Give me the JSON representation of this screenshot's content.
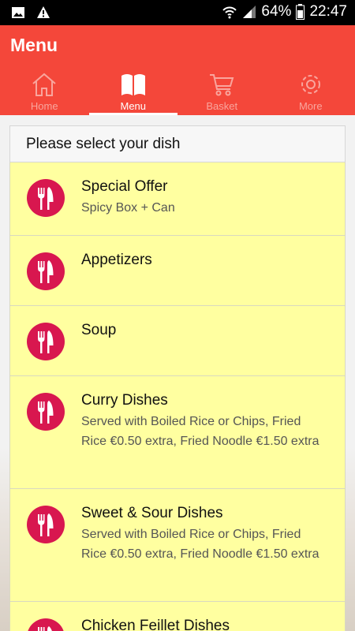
{
  "status_bar": {
    "battery": "64%",
    "time": "22:47"
  },
  "header": {
    "title": "Menu"
  },
  "tabs": [
    {
      "label": "Home"
    },
    {
      "label": "Menu"
    },
    {
      "label": "Basket"
    },
    {
      "label": "More"
    }
  ],
  "menu": {
    "heading": "Please select your dish",
    "items": [
      {
        "name": "Special Offer",
        "desc": "Spicy Box + Can"
      },
      {
        "name": "Appetizers",
        "desc": ""
      },
      {
        "name": "Soup",
        "desc": ""
      },
      {
        "name": "Curry Dishes",
        "desc": "Served with Boiled Rice or Chips, Fried Rice €0.50 extra, Fried Noodle €1.50 extra"
      },
      {
        "name": "Sweet & Sour Dishes",
        "desc": "Served with Boiled Rice or Chips, Fried Rice €0.50 extra, Fried Noodle €1.50 extra"
      },
      {
        "name": "Chicken Feillet Dishes",
        "desc": ""
      }
    ]
  },
  "colors": {
    "accent": "#f4473a",
    "item_bg": "#ffffa0",
    "icon": "#d8174f"
  }
}
